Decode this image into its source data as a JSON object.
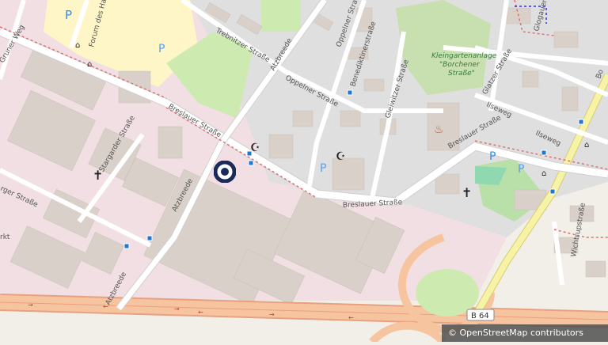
{
  "map": {
    "streets": {
      "trebnitzer": "Trebnitzer Straße",
      "oppelner_top": "Oppelner Straße",
      "oppelner": "Oppelner Straße",
      "benediktiner": "Benediktinerstraße",
      "gleiwitzer": "Gleiwitzer Straße",
      "breslauer_w": "Breslauer Straße",
      "breslauer_s": "Breslauer Straße",
      "breslauer_e": "Breslauer Straße",
      "atzbreede_n": "Atzbreede",
      "atzbreede_m": "Atzbreede",
      "atzbreede_s": "Atzbreede",
      "stargarder": "Stargarder Straße",
      "gruner_weg": "Gruner Weg",
      "rger": "rger Straße",
      "glatzer": "Glatzer Straße",
      "ilseweg_1": "Ilseweg",
      "ilseweg_2": "Ilseweg",
      "glogauer": "Glogauer",
      "wichtrup": "Wichtrupstraße",
      "forum": "Forum des Handw",
      "rkt": "rkt",
      "bo": "Bo"
    },
    "garden_label_1": "Kleingartenanlage",
    "garden_label_2": "\"Borchener",
    "garden_label_3": "Straße\"",
    "road_shield": "B 64",
    "parking_symbol": "P"
  },
  "attribution": {
    "copyright": "© OpenStreetMap contributors"
  },
  "colors": {
    "industrial": "#f2dfe3",
    "building": "#d9d0c9",
    "park": "#c8facc",
    "motorway": "#f7c4a0",
    "primary_road": "#f6f3a7",
    "marker": "#1a2a5a"
  }
}
